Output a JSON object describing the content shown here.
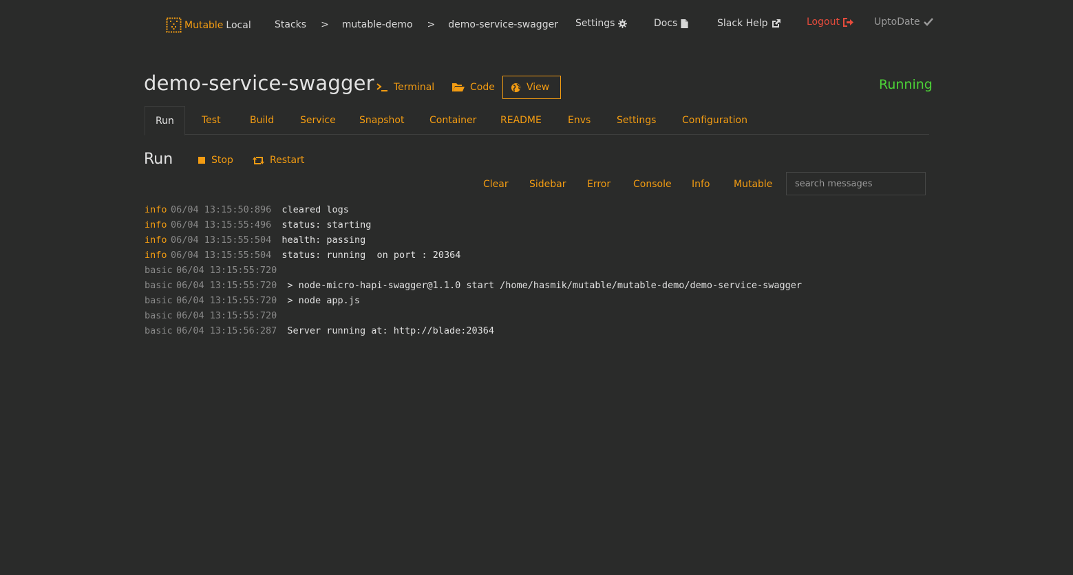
{
  "brand": {
    "name": "Mutable",
    "suffix": "Local",
    "logo_icon": "mutable-logo-icon",
    "accent_color": "#f39c12"
  },
  "breadcrumb": {
    "items": [
      "Stacks",
      "mutable-demo",
      "demo-service-swagger"
    ],
    "separator": ">"
  },
  "nav": {
    "settings": "Settings",
    "docs": "Docs",
    "slack_help": "Slack Help",
    "logout": "Logout",
    "status": "UptoDate"
  },
  "header": {
    "title": "demo-service-swagger",
    "actions": {
      "terminal": "Terminal",
      "code": "Code",
      "view": "View"
    },
    "status": "Running",
    "status_color": "#4cd137"
  },
  "tabs": [
    "Run",
    "Test",
    "Build",
    "Service",
    "Snapshot",
    "Container",
    "README",
    "Envs",
    "Settings",
    "Configuration"
  ],
  "active_tab": "Run",
  "run": {
    "title": "Run",
    "stop": "Stop",
    "restart": "Restart"
  },
  "filters": {
    "items": [
      "Clear",
      "Sidebar",
      "Error",
      "Console",
      "Info",
      "Mutable"
    ],
    "search_placeholder": "search messages"
  },
  "log": [
    {
      "level": "info",
      "time": "06/04 13:15:50:896",
      "message": "cleared logs"
    },
    {
      "level": "info",
      "time": "06/04 13:15:55:496",
      "message": "status: starting"
    },
    {
      "level": "info",
      "time": "06/04 13:15:55:504",
      "message": "health: passing"
    },
    {
      "level": "info",
      "time": "06/04 13:15:55:504",
      "message": "status: running  on port : 20364"
    },
    {
      "level": "basic",
      "time": "06/04 13:15:55:720",
      "message": ""
    },
    {
      "level": "basic",
      "time": "06/04 13:15:55:720",
      "message": "> node-micro-hapi-swagger@1.1.0 start /home/hasmik/mutable/mutable-demo/demo-service-swagger"
    },
    {
      "level": "basic",
      "time": "06/04 13:15:55:720",
      "message": "> node app.js"
    },
    {
      "level": "basic",
      "time": "06/04 13:15:55:720",
      "message": ""
    },
    {
      "level": "basic",
      "time": "06/04 13:15:56:287",
      "message": "Server running at: http://blade:20364"
    }
  ]
}
